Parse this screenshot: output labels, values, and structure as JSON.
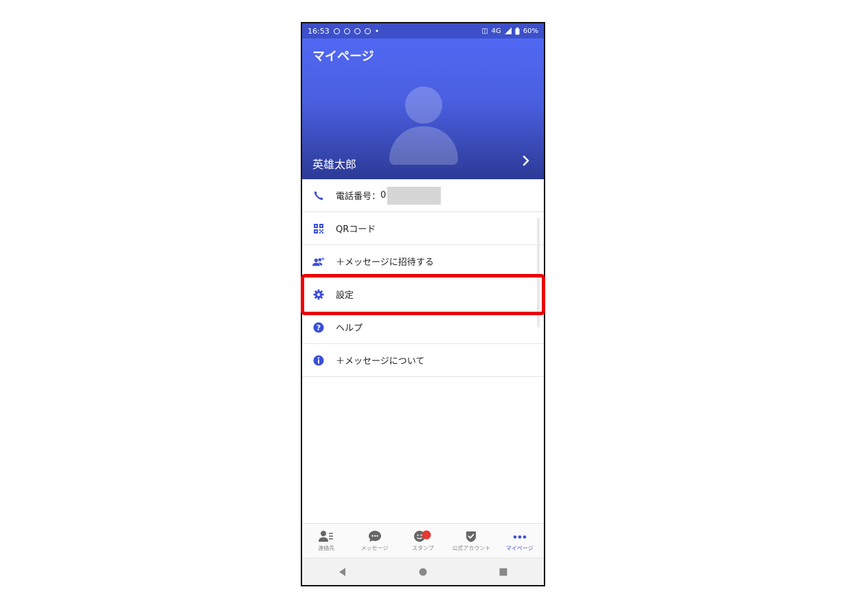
{
  "status_bar": {
    "time": "16:53",
    "network": "4G",
    "battery": "60%"
  },
  "header": {
    "title": "マイページ",
    "user_name": "英雄太郎"
  },
  "menu": [
    {
      "id": "phone",
      "label": "電話番号：",
      "value": "0",
      "icon": "phone-icon"
    },
    {
      "id": "qr",
      "label": "QRコード",
      "icon": "qr-code-icon"
    },
    {
      "id": "invite",
      "label": "＋メッセージに招待する",
      "icon": "add-people-icon"
    },
    {
      "id": "settings",
      "label": "設定",
      "icon": "gear-icon"
    },
    {
      "id": "help",
      "label": "ヘルプ",
      "icon": "help-icon"
    },
    {
      "id": "about",
      "label": "＋メッセージについて",
      "icon": "info-icon"
    }
  ],
  "tabs": [
    {
      "label": "連絡先",
      "icon": "contacts-icon"
    },
    {
      "label": "メッセージ",
      "icon": "message-icon"
    },
    {
      "label": "スタンプ",
      "icon": "sticker-icon"
    },
    {
      "label": "公式アカウント",
      "icon": "official-account-icon"
    },
    {
      "label": "マイページ",
      "icon": "more-icon",
      "active": true
    }
  ],
  "colors": {
    "accent": "#3b4fd8",
    "header_top": "#5068f2",
    "header_bottom": "#2c3a96",
    "highlight": "#ee0000",
    "badge": "#e53935"
  }
}
